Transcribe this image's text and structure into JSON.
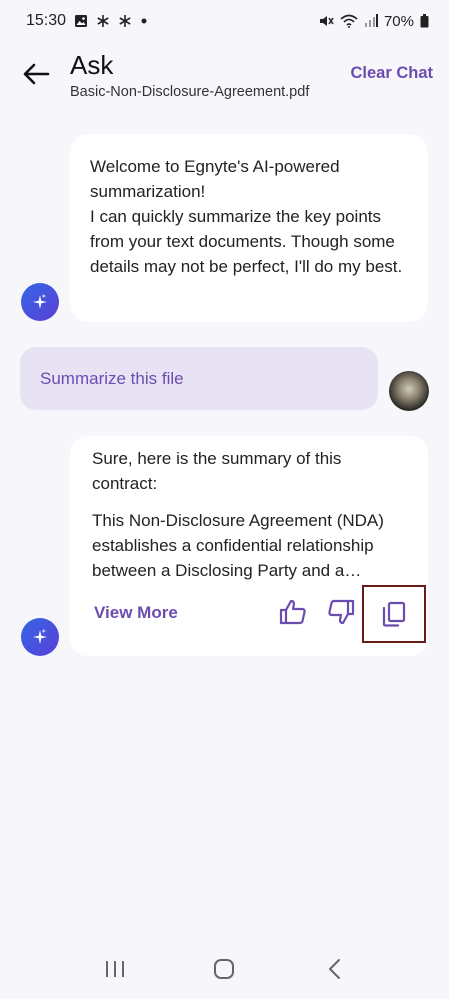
{
  "status_bar": {
    "time": "15:30",
    "battery": "70%",
    "icons": [
      "image-icon",
      "asterisk-icon",
      "asterisk-icon",
      "dot-icon",
      "mute-icon",
      "wifi-icon",
      "signal-icon",
      "battery-icon"
    ]
  },
  "header": {
    "title": "Ask",
    "subtitle": "Basic-Non-Disclosure-Agreement.pdf",
    "clear_chat": "Clear Chat"
  },
  "messages": {
    "welcome": "Welcome to Egnyte's AI-powered summarization!\nI can quickly summarize the key points from your text documents. Though some details may not be perfect, I'll do my best.",
    "user_prompt": "Summarize this file",
    "reply_intro": "Sure, here is the summary of this contract:",
    "reply_excerpt": "This Non-Disclosure Agreement (NDA) establishes a confidential relationship between a Disclosing Party and a Receiving Party...",
    "view_more": "View More"
  },
  "colors": {
    "accent": "#6b4db0",
    "user_bubble": "#e8e3f4",
    "highlight_border": "#6b1a1a"
  }
}
